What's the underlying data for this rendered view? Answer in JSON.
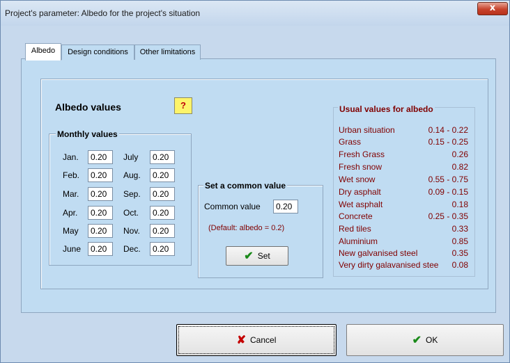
{
  "window": {
    "title": "Project's parameter: Albedo for the project's situation",
    "close_label": "x"
  },
  "tabs": [
    "Albedo",
    "Design conditions",
    "Other limitations"
  ],
  "section_title": "Albedo values",
  "help_label": "?",
  "monthly": {
    "title": "Monthly values",
    "left": [
      {
        "label": "Jan.",
        "value": "0.20"
      },
      {
        "label": "Feb.",
        "value": "0.20"
      },
      {
        "label": "Mar.",
        "value": "0.20"
      },
      {
        "label": "Apr.",
        "value": "0.20"
      },
      {
        "label": "May",
        "value": "0.20"
      },
      {
        "label": "June",
        "value": "0.20"
      }
    ],
    "right": [
      {
        "label": "July",
        "value": "0.20"
      },
      {
        "label": "Aug.",
        "value": "0.20"
      },
      {
        "label": "Sep.",
        "value": "0.20"
      },
      {
        "label": "Oct.",
        "value": "0.20"
      },
      {
        "label": "Nov.",
        "value": "0.20"
      },
      {
        "label": "Dec.",
        "value": "0.20"
      }
    ]
  },
  "common": {
    "title": "Set a common value",
    "label": "Common value",
    "value": "0.20",
    "note": "(Default: albedo = 0.2)",
    "set_label": "Set"
  },
  "usual": {
    "title": "Usual values for albedo",
    "items": [
      {
        "name": "Urban situation",
        "value": "0.14 - 0.22"
      },
      {
        "name": "Grass",
        "value": "0.15 - 0.25"
      },
      {
        "name": "Fresh Grass",
        "value": "0.26"
      },
      {
        "name": "Fresh snow",
        "value": "0.82"
      },
      {
        "name": "Wet snow",
        "value": "0.55 - 0.75"
      },
      {
        "name": "Dry asphalt",
        "value": "0.09 - 0.15"
      },
      {
        "name": "Wet asphalt",
        "value": "0.18"
      },
      {
        "name": "Concrete",
        "value": "0.25 - 0.35"
      },
      {
        "name": "Red tiles",
        "value": "0.33"
      },
      {
        "name": "Aluminium",
        "value": "0.85"
      },
      {
        "name": "New galvanised steel",
        "value": "0.35"
      },
      {
        "name": "Very dirty galavanised stee",
        "value": "0.08"
      }
    ]
  },
  "buttons": {
    "cancel": "Cancel",
    "ok": "OK"
  },
  "icons": {
    "check": "check-icon",
    "cross": "cross-icon",
    "help": "help-icon",
    "close": "close-icon"
  },
  "colors": {
    "panel": "#c0dcf2",
    "dark_red": "#800000",
    "green": "#1a8a1a",
    "red": "#c40000"
  }
}
